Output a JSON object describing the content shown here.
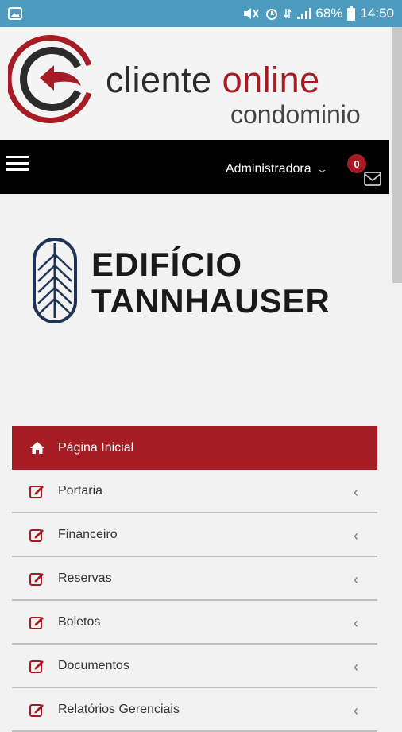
{
  "statusbar": {
    "battery": "68%",
    "time": "14:50"
  },
  "brand": {
    "line1_a": "cliente ",
    "line1_b": "online",
    "line2": "condominio"
  },
  "topbar": {
    "user_label": "Administradora",
    "badge_count": "0"
  },
  "building": {
    "title_line1": "EDIFÍCIO",
    "title_line2": "TANNHAUSER"
  },
  "menu": [
    {
      "label": "Página Inicial",
      "icon": "home-icon",
      "active": true
    },
    {
      "label": "Portaria",
      "icon": "edit-icon"
    },
    {
      "label": "Financeiro",
      "icon": "edit-icon"
    },
    {
      "label": "Reservas",
      "icon": "edit-icon"
    },
    {
      "label": "Boletos",
      "icon": "edit-icon"
    },
    {
      "label": "Documentos",
      "icon": "edit-icon"
    },
    {
      "label": "Relatórios Gerenciais",
      "icon": "edit-icon"
    }
  ],
  "colors": {
    "accent": "#a51c24",
    "statusbar": "#4d9bbf"
  }
}
